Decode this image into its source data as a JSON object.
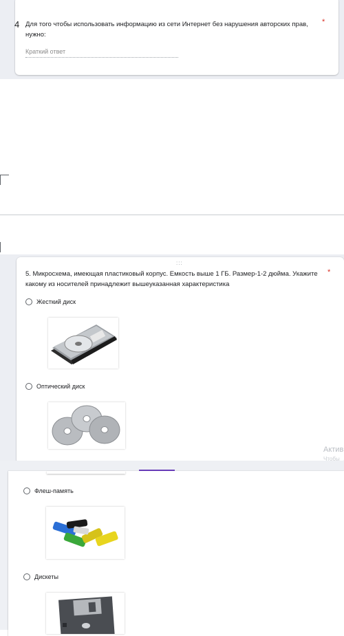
{
  "q4": {
    "number": "4",
    "text": "Для того чтобы использовать информацию из сети Интернет без нарушения авторских прав, нужно:",
    "required": "*",
    "placeholder": "Краткий ответ"
  },
  "q5": {
    "drag_handle": ":::",
    "text": "5. Микросхема, имеющая пластиковый корпус. Емкость выше 1 ГБ. Размер-1-2 дюйма. Укажите какому из носителей принадлежит вышеуказанная характеристика",
    "required": "*",
    "options": [
      {
        "label": "Жесткий диск",
        "image": "hard-disk-image"
      },
      {
        "label": "Оптический диск",
        "image": "optical-disc-image"
      },
      {
        "label": "Флеш-память",
        "image": "flash-drive-image"
      },
      {
        "label": "Дискеты",
        "image": "floppy-disk-image"
      }
    ]
  },
  "watermark": {
    "line1": "Актив",
    "line2": "Чтобы"
  },
  "colors": {
    "accent": "#673ab7",
    "required": "#d93025",
    "background": "#eceef3"
  }
}
